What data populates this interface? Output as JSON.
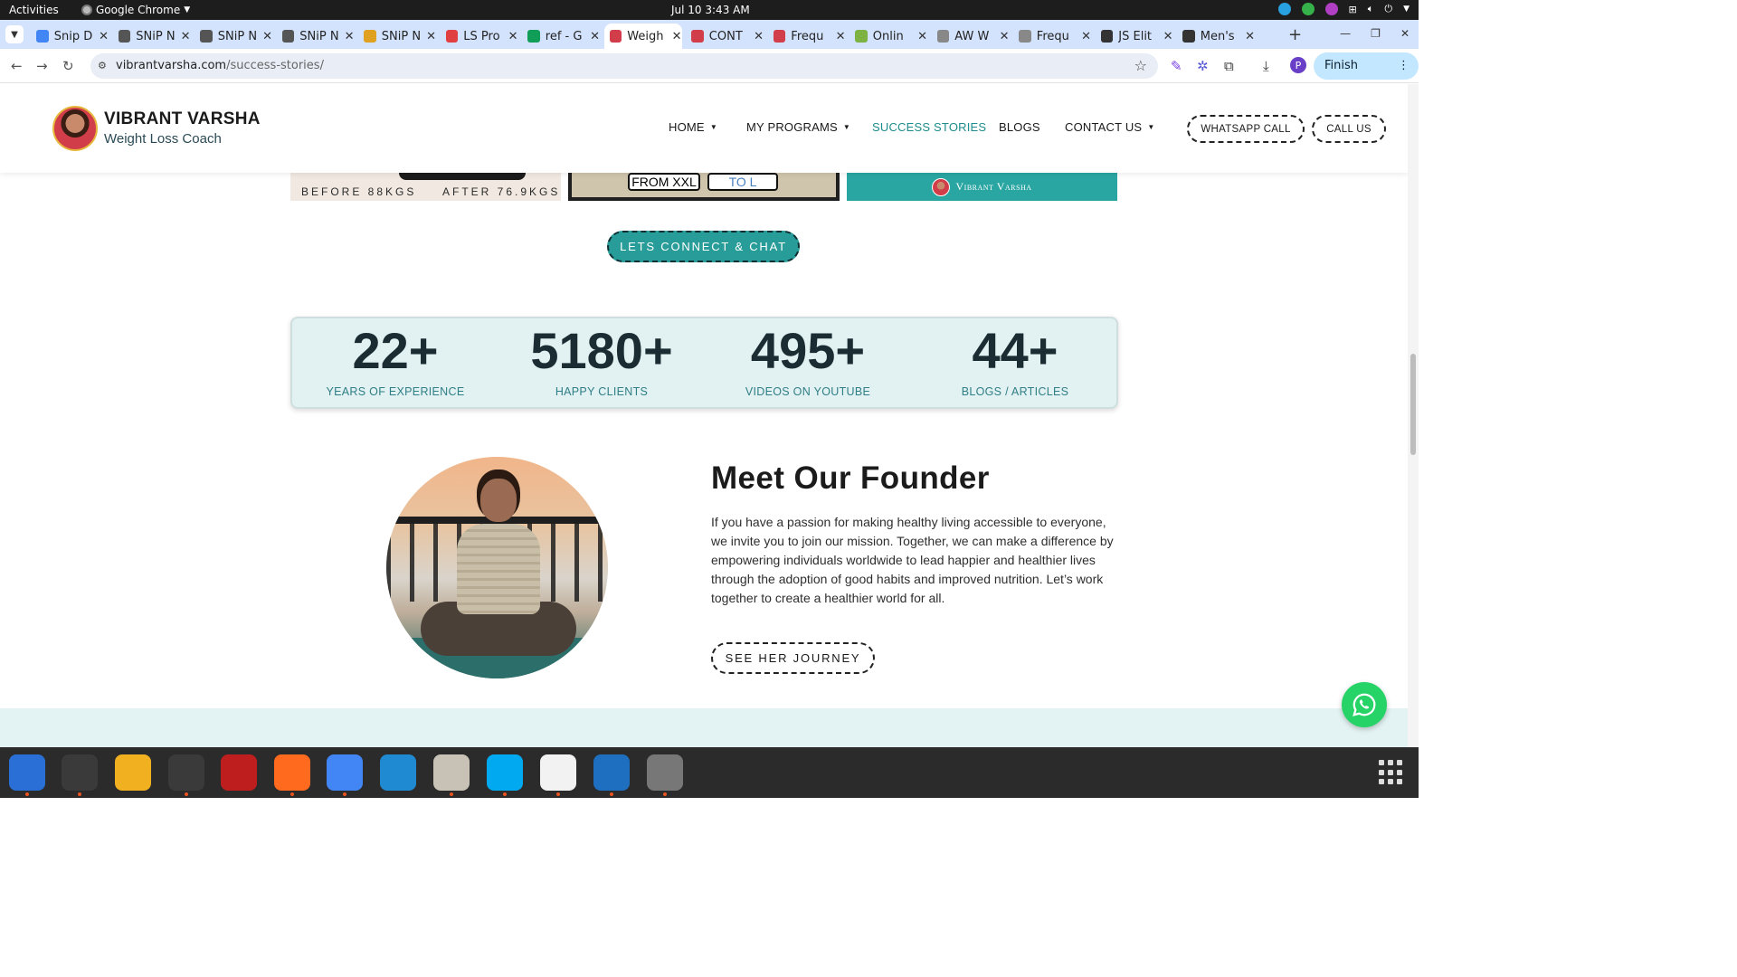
{
  "system": {
    "activities": "Activities",
    "app_name": "Google Chrome",
    "clock": "Jul 10  3:43 AM"
  },
  "tabs": [
    {
      "title": "Snip D",
      "icon": "docs-icon",
      "color": "#4285f4"
    },
    {
      "title": "SNiP N",
      "icon": "snip-icon",
      "color": "#555555"
    },
    {
      "title": "SNiP N",
      "icon": "snip-icon",
      "color": "#555555"
    },
    {
      "title": "SNiP N",
      "icon": "snip-icon",
      "color": "#555555"
    },
    {
      "title": "SNiP N",
      "icon": "snip-icon",
      "color": "#e0a020"
    },
    {
      "title": "LS Pro",
      "icon": "ls-icon",
      "color": "#e04040"
    },
    {
      "title": "ref - G",
      "icon": "sheets-icon",
      "color": "#0f9d58"
    },
    {
      "title": "Weigh",
      "icon": "vv-icon",
      "color": "#d23d4a",
      "active": true
    },
    {
      "title": "CONT",
      "icon": "vv-icon",
      "color": "#d23d4a"
    },
    {
      "title": "Frequ",
      "icon": "vv-icon",
      "color": "#d23d4a"
    },
    {
      "title": "Onlin",
      "icon": "image-icon",
      "color": "#7cb342"
    },
    {
      "title": "AW W",
      "icon": "aw-icon",
      "color": "#888888"
    },
    {
      "title": "Frequ",
      "icon": "aw-icon",
      "color": "#888888"
    },
    {
      "title": "JS Elit",
      "icon": "shield-icon",
      "color": "#333333"
    },
    {
      "title": "Men's",
      "icon": "shield-icon",
      "color": "#333333"
    }
  ],
  "toolbar": {
    "url_host": "vibrantvarsha.com",
    "url_path": "/success-stories/",
    "finish_update": "Finish update",
    "profile_initial": "P"
  },
  "site": {
    "brand_name": "VIBRANT VARSHA",
    "brand_sub": "Weight Loss Coach",
    "menu": [
      {
        "label": "HOME",
        "caret": true
      },
      {
        "label": "MY PROGRAMS",
        "caret": true
      },
      {
        "label": "SUCCESS STORIES",
        "caret": false,
        "current": true
      },
      {
        "label": "BLOGS",
        "caret": false
      },
      {
        "label": "CONTACT US",
        "caret": true
      }
    ],
    "whatsapp_call": "WHATSAPP CALL",
    "call_us": "CALL US"
  },
  "gallery": {
    "before": "BEFORE 88KGS",
    "after": "AFTER 76.9KGS",
    "from": "FROM XXL",
    "to": "TO L",
    "brand_badge": "Vibrant Varsha"
  },
  "cta": "LETS CONNECT & CHAT",
  "stats": [
    {
      "value": "22+",
      "label": "YEARS OF EXPERIENCE"
    },
    {
      "value": "5180+",
      "label": "HAPPY CLIENTS"
    },
    {
      "value": "495+",
      "label": "VIDEOS ON YOUTUBE"
    },
    {
      "value": "44+",
      "label": "BLOGS / ARTICLES"
    }
  ],
  "founder": {
    "title": "Meet Our Founder",
    "text": "If you have a passion for making healthy living accessible to everyone, we invite you to join our mission. Together, we can make a difference by empowering individuals worldwide to lead happier and healthier lives through the adoption of good habits and improved nutrition. Let’s work together to create a healthier world for all.",
    "button": "SEE HER JOURNEY"
  },
  "colors": {
    "teal": "#279c98",
    "teal_text": "#2f7f86",
    "stats_bg": "#e2f1f1",
    "whatsapp": "#25d366",
    "chrome_tabstrip": "#d3e3fd"
  },
  "dock": [
    {
      "name": "thunderbird-icon",
      "color": "#2a6fd6",
      "running": true
    },
    {
      "name": "terminal-icon",
      "color": "#3a3a3a",
      "running": true
    },
    {
      "name": "calculator-icon",
      "color": "#f0b020",
      "running": false
    },
    {
      "name": "system-monitor-icon",
      "color": "#3a3a3a",
      "running": true
    },
    {
      "name": "filezilla-icon",
      "color": "#bf1e1e",
      "running": false
    },
    {
      "name": "firefox-icon",
      "color": "#ff6a1f",
      "running": true
    },
    {
      "name": "chrome-icon",
      "color": "#4285f4",
      "running": true
    },
    {
      "name": "vscode-icon",
      "color": "#1f8ad2",
      "running": false
    },
    {
      "name": "files-icon",
      "color": "#c8c2b6",
      "running": true
    },
    {
      "name": "skype-icon",
      "color": "#00a9f0",
      "running": true
    },
    {
      "name": "text-editor-icon",
      "color": "#f2f2f2",
      "running": true
    },
    {
      "name": "document-viewer-icon",
      "color": "#1e6fbf",
      "running": true
    },
    {
      "name": "disk-icon",
      "color": "#777777",
      "running": true
    }
  ]
}
